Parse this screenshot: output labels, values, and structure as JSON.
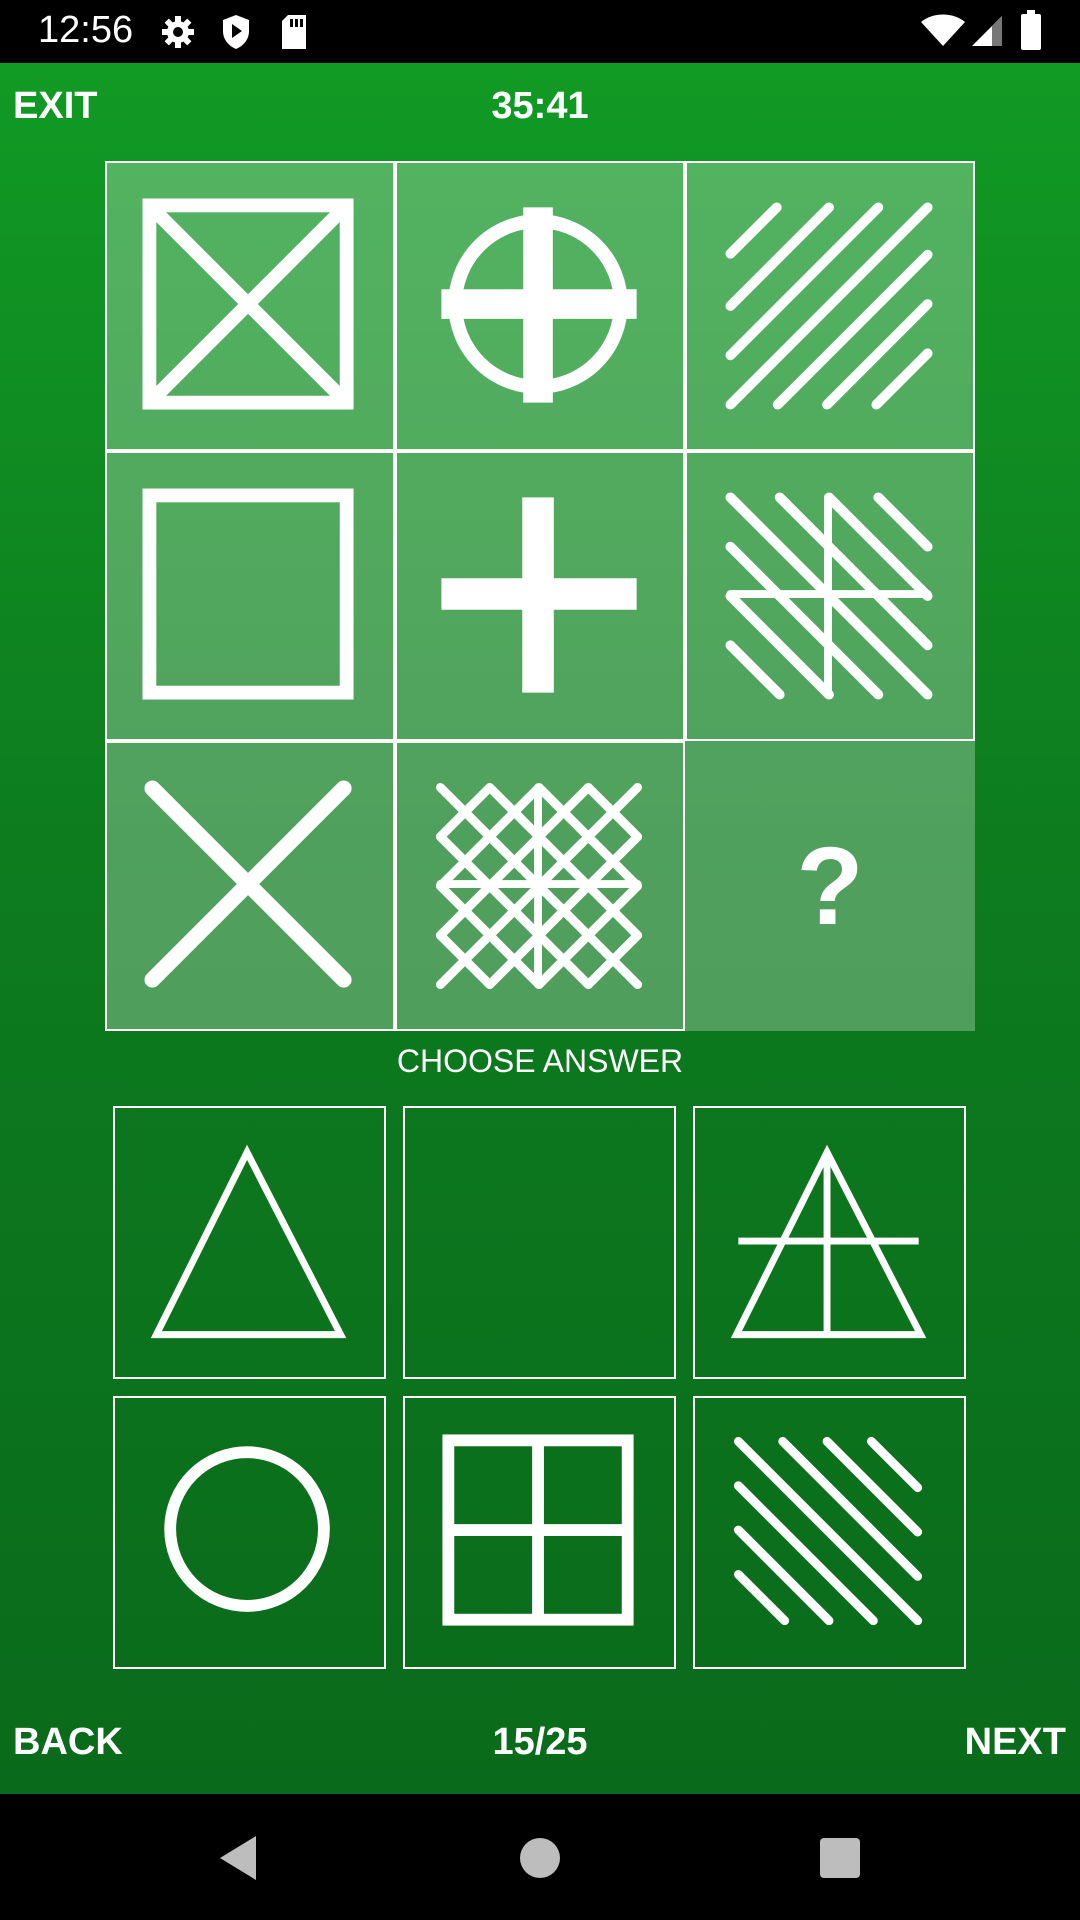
{
  "status_bar": {
    "time": "12:56",
    "icons": [
      "settings-icon",
      "shield-icon",
      "sd-card-icon",
      "wifi-icon",
      "signal-icon",
      "battery-icon"
    ]
  },
  "header": {
    "exit_label": "EXIT",
    "timer": "35:41"
  },
  "puzzle": {
    "cells": [
      {
        "row": 1,
        "col": 1,
        "figure": "square-with-x"
      },
      {
        "row": 1,
        "col": 2,
        "figure": "circle-with-cross"
      },
      {
        "row": 1,
        "col": 3,
        "figure": "diagonal-lines"
      },
      {
        "row": 2,
        "col": 1,
        "figure": "square"
      },
      {
        "row": 2,
        "col": 2,
        "figure": "cross"
      },
      {
        "row": 2,
        "col": 3,
        "figure": "diagonal-lines-with-cross"
      },
      {
        "row": 3,
        "col": 1,
        "figure": "x"
      },
      {
        "row": 3,
        "col": 2,
        "figure": "crosshatch-with-cross"
      },
      {
        "row": 3,
        "col": 3,
        "figure": "unknown"
      }
    ],
    "missing_symbol": "?"
  },
  "choose_label": "CHOOSE ANSWER",
  "answers": [
    {
      "index": 1,
      "figure": "triangle"
    },
    {
      "index": 2,
      "figure": "empty"
    },
    {
      "index": 3,
      "figure": "triangle-with-cross"
    },
    {
      "index": 4,
      "figure": "circle"
    },
    {
      "index": 5,
      "figure": "square-with-cross"
    },
    {
      "index": 6,
      "figure": "diagonal-lines"
    }
  ],
  "footer": {
    "back_label": "BACK",
    "progress": "15/25",
    "next_label": "NEXT"
  },
  "colors": {
    "background_top": "#119a24",
    "background_bottom": "#0a6a1b",
    "cell_fill": "rgba(255,255,255,0.28)",
    "stroke": "#ffffff"
  }
}
